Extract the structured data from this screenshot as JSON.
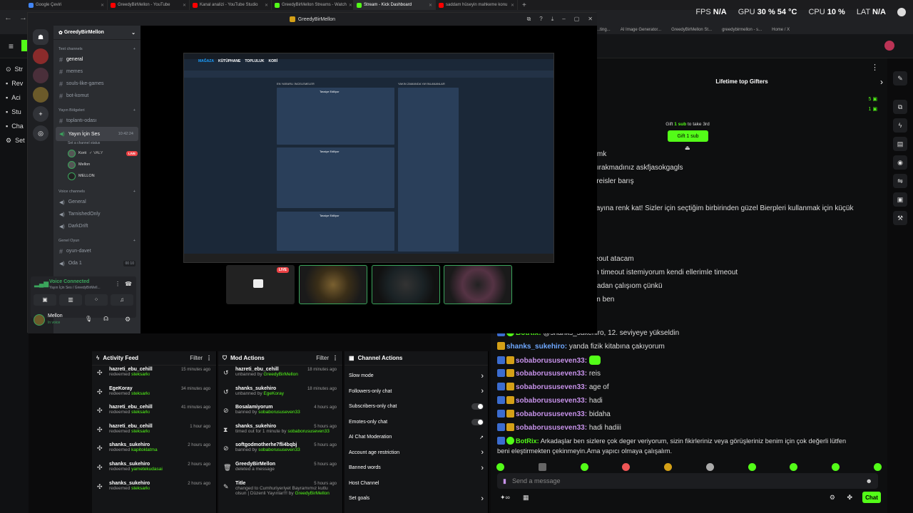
{
  "browser": {
    "tabs": [
      {
        "label": "Google Çeviri",
        "color": "#4285f4"
      },
      {
        "label": "GreedyBirMellon - YouTube",
        "color": "#ff0000"
      },
      {
        "label": "Kanal analizi - YouTube Studio",
        "color": "#ff0000"
      },
      {
        "label": "GreedyBirMellon Streams - Watch",
        "color": "#53fc18"
      },
      {
        "label": "Stream - Kick Dashboard",
        "color": "#53fc18"
      },
      {
        "label": "saddam hüseyin mahkeme konu",
        "color": "#ff0000"
      }
    ],
    "bookmarks": [
      "...ting...",
      "AI Image Generator...",
      "GreedyBirMellon St...",
      "greedybirmellon - s...",
      "Home / X"
    ]
  },
  "stats": {
    "fps_label": "FPS",
    "fps_value": "N/A",
    "gpu_label": "GPU",
    "gpu_value": "30 %",
    "gpu_temp": "54 °C",
    "cpu_label": "CPU",
    "cpu_value": "10 %",
    "lat_label": "LAT",
    "lat_value": "N/A"
  },
  "kick_sidebar": [
    "Str",
    "Rev",
    "Aci",
    "Stu",
    "Cha",
    "Set"
  ],
  "gifters": {
    "title": "Lifetime top Gifters",
    "counts": [
      "5",
      "1"
    ],
    "gift_prompt_pre": "Gift",
    "gift_prompt_sub": "1 sub",
    "gift_prompt_post": "to take 3rd",
    "gift_button": "Gift 1 sub"
  },
  "chat_partial": [
    "od mk",
    "a bırakmadınız askfjasokgagls",
    "se reisler barış",
    "şş",
    "k yayına renk kat! Sizler için seçtiğim birbirinden güzel Bierpleri kullanmak için küçük",
    "ml",
    "imeout atacam",
    "dan timeout istemiyorum kendi ellerimle timeout",
    "arkadan çalışıom çünkü",
    "yom ben"
  ],
  "chat": [
    {
      "user": "BotRix:",
      "text": "@shanks_sukehiro, 12. seviyeye yükseldin",
      "color": "#53fc18"
    },
    {
      "user": "shanks_sukehiro:",
      "text": "yanda fizik kitabına çakıyorum",
      "color": "#6fa8ff"
    },
    {
      "user": "sobaborususeven33:",
      "text": "",
      "color": "#c792ea"
    },
    {
      "user": "sobaborususeven33:",
      "text": "reis",
      "color": "#c792ea"
    },
    {
      "user": "sobaborususeven33:",
      "text": "age of",
      "color": "#c792ea"
    },
    {
      "user": "sobaborususeven33:",
      "text": "hadi",
      "color": "#c792ea"
    },
    {
      "user": "sobaborususeven33:",
      "text": "bidaha",
      "color": "#c792ea"
    },
    {
      "user": "sobaborususeven33:",
      "text": "hadi hadiii",
      "color": "#c792ea"
    },
    {
      "user": "BotRix:",
      "text": "Arkadaşlar ben sizlere çok deger veriyorum, sizin fikirleriniz veya görüşleriniz benim için çok değerli lütfen",
      "color": "#53fc18"
    }
  ],
  "chat_last_line2": "beni eleştirmekten çekinmeyin.Ama yapıcı olmaya çalışalım.",
  "message_placeholder": "Send a message",
  "chat_button": "Chat",
  "activity": {
    "title": "Activity Feed",
    "filter": "Filter",
    "items": [
      {
        "user": "hazreti_ebu_cehill",
        "action": "redeemed",
        "target": "steksarkı",
        "time": "15 minutes ago"
      },
      {
        "user": "EgeKoray",
        "action": "redeemed",
        "target": "steksarkı",
        "time": "34 minutes ago"
      },
      {
        "user": "hazreti_ebu_cehill",
        "action": "redeemed",
        "target": "steksarkı",
        "time": "41 minutes ago"
      },
      {
        "user": "hazreti_ebu_cehill",
        "action": "redeemed",
        "target": "steksarkı",
        "time": "1 hour ago"
      },
      {
        "user": "shanks_sukehiro",
        "action": "redeemed",
        "target": "kapitoklatma",
        "time": "2 hours ago"
      },
      {
        "user": "shanks_sukehiro",
        "action": "redeemed",
        "target": "yametekudasai",
        "time": "2 hours ago"
      },
      {
        "user": "shanks_sukehiro",
        "action": "redeemed",
        "target": "steksarkı",
        "time": "2 hours ago"
      }
    ]
  },
  "mod": {
    "title": "Mod Actions",
    "filter": "Filter",
    "items": [
      {
        "user": "hazreti_ebu_cehill",
        "line": "unbanned by",
        "by": "GreedyBirMellon",
        "time": "18 minutes ago",
        "icon": "↺"
      },
      {
        "user": "shanks_sukehiro",
        "line": "unbanned by",
        "by": "EgeKoray",
        "time": "18 minutes ago",
        "icon": "↺"
      },
      {
        "user": "Bosalamiyorum",
        "line": "banned by",
        "by": "sobaborususeven33",
        "time": "4 hours ago",
        "icon": "⊘"
      },
      {
        "user": "shanks_sukehiro",
        "line": "timed out for 1 minute by",
        "by": "sobaborususeven33",
        "time": "5 hours ago",
        "icon": "⧗"
      },
      {
        "user": "softgodmotherhe7fli4bqbj",
        "line": "banned by",
        "by": "sobaborususeven33",
        "time": "5 hours ago",
        "icon": "⊘"
      },
      {
        "user": "GreedyBirMellon",
        "line": "deleted a message",
        "by": "",
        "time": "5 hours ago",
        "icon": "🗑"
      },
      {
        "user": "Title",
        "line": "changed to Cumhuriyeriyet Bayramımız kutlu olsun | Düzenli Yayınlar!!! by",
        "by": "GreedyBirMellon",
        "time": "5 hours ago",
        "icon": "✎"
      }
    ]
  },
  "channel_actions": {
    "title": "Channel Actions",
    "items": [
      {
        "label": "Slow mode",
        "kind": "arrow"
      },
      {
        "label": "Followers-only chat",
        "kind": "arrow"
      },
      {
        "label": "Subscribers-only chat",
        "kind": "toggle"
      },
      {
        "label": "Emotes-only chat",
        "kind": "toggle"
      },
      {
        "label": "AI Chat Moderation",
        "kind": "link"
      },
      {
        "label": "Account age restriction",
        "kind": "arrow"
      },
      {
        "label": "Banned words",
        "kind": "arrow"
      },
      {
        "label": "Host Channel",
        "kind": "none"
      },
      {
        "label": "Set goals",
        "kind": "arrow"
      }
    ]
  },
  "discord": {
    "window_title": "GreedyBirMellon",
    "server": "GreedyBirMellon",
    "text_cat": "Text channels",
    "text_channels": [
      "general",
      "memes",
      "souls-like-games",
      "bot-komut"
    ],
    "yb_cat": "Yayın Bölgeleri",
    "yb_channels": [
      "toplantı-odası"
    ],
    "voice_active": "Yayın İçin Ses",
    "voice_timer": "10:42:24",
    "voice_status": "Set a channel status",
    "voice_users": [
      {
        "name": "Korii",
        "extra": "VALY",
        "live": "LIVE"
      },
      {
        "name": "Mellon",
        "extra": "",
        "live": ""
      },
      {
        "name": "MELLON",
        "extra": "",
        "live": ""
      }
    ],
    "voice_cat": "Voice channels",
    "voice_channels": [
      "General",
      "TarnishedOnly",
      "DarkDrift"
    ],
    "genel_cat": "Genel Oyun",
    "genel_channels": [
      "oyun-davet",
      "Oda 1"
    ],
    "oda_counts": "00  10",
    "connected": "Voice Connected",
    "connected_sub": "Yayın İçin Ses / GreedyBirMell...",
    "user": "Mellon",
    "user_status": "In voice",
    "live_badge": "LIVE"
  },
  "steam": {
    "tabs": [
      "MAĞAZA",
      "KÜTÜPHANE",
      "TOPLULUK",
      "KORİ"
    ],
    "section_left": "EN YARARLI İNCELEMELER",
    "section_right": "YAKIN ZAMANDA YAYINLANANLAR",
    "review_tag": "Tavsiye Ediliyor"
  }
}
